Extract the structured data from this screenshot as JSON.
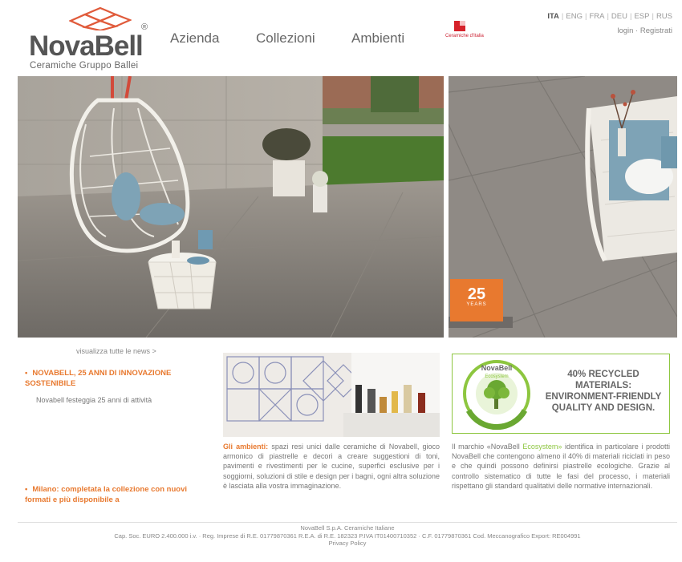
{
  "header": {
    "logo_word": "NovaBell",
    "logo_registered": "®",
    "logo_sub": "Ceramiche Gruppo Ballei",
    "nav": [
      "Azienda",
      "Collezioni",
      "Ambienti"
    ],
    "badge_text": "Ceramiche d'Italia",
    "languages": [
      "ITA",
      "ENG",
      "FRA",
      "DEU",
      "ESP",
      "RUS"
    ],
    "active_language": "ITA",
    "login": "login",
    "register": "Registrati"
  },
  "hero": {
    "years_number": "25",
    "years_label": "YEARS"
  },
  "news": {
    "view_all": "visualizza tutte le news >",
    "items": [
      {
        "title": "NOVABELL, 25 ANNI DI INNOVAZIONE SOSTENIBILE",
        "subtitle": "Novabell festeggia 25 anni di attività"
      },
      {
        "title": "Milano: completata la collezione con nuovi formati e più disponibile a"
      }
    ]
  },
  "ambienti": {
    "highlight": "Gli ambienti:",
    "text": "spazi resi unici dalle ceramiche di Novabell, gioco armonico di piastrelle e decori a creare suggestioni di toni, pavimenti e rivestimenti per le cucine, superfici esclusive per i soggiorni, soluzioni di stile e design per i bagni, ogni altra soluzione è lasciata alla vostra immaginazione."
  },
  "eco": {
    "logo_label": "NovaBell",
    "logo_sub": "Ecosystem",
    "title_lines": [
      "40% RECYCLED",
      "MATERIALS:",
      "ENVIRONMENT-FRIENDLY",
      "QUALITY AND DESIGN."
    ],
    "text_before": "Il marchio «NovaBell",
    "text_highlight": "Ecosystem»",
    "text_after": "identifica in particolare i prodotti NovaBell che contengono almeno il 40% di materiali riciclati in peso e che quindi possono definirsi piastrelle ecologiche. Grazie al controllo sistematico di tutte le fasi del processo, i materiali rispettano gli standard qualitativi delle normative internazionali."
  },
  "footer": {
    "line1": "NovaBell S.p.A. Ceramiche Italiane",
    "line2": "Cap. Soc. EURO 2.400.000 i.v. · Reg. Imprese di R.E. 01779870361 R.E.A. di R.E. 182323 P.IVA IT01400710352 · C.F. 01779870361 Cod. Meccanografico Export: RE004991",
    "line3": "Privacy Policy"
  },
  "colors": {
    "accent_orange": "#e8792f",
    "eco_green": "#8dc63f",
    "logo_red": "#e05a3a"
  }
}
